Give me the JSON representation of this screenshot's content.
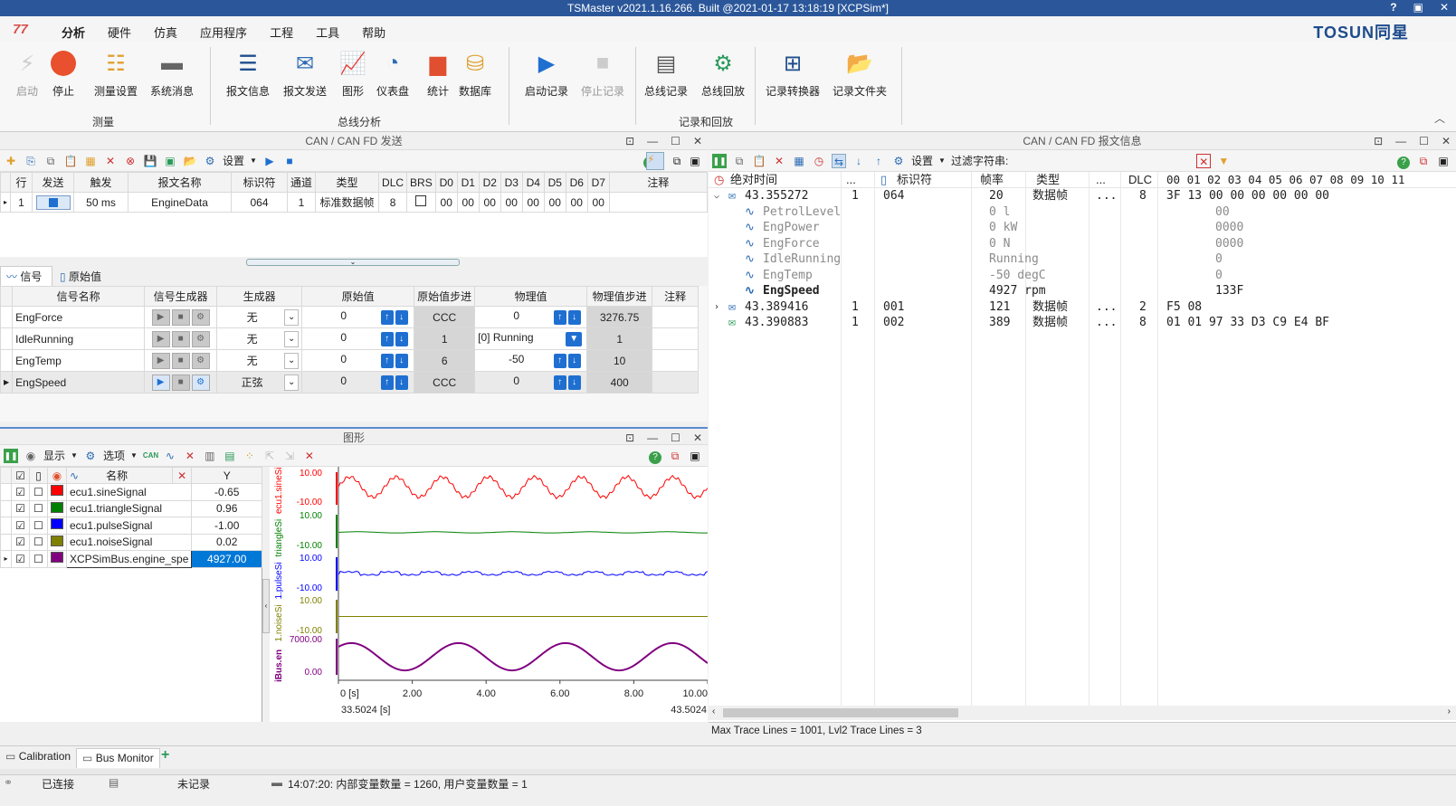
{
  "window": {
    "title": "TSMaster v2021.1.16.266. Built @2021-01-17 13:18:19 [XCPSim*]",
    "help": "?"
  },
  "menu": {
    "items": [
      "分析",
      "硬件",
      "仿真",
      "应用程序",
      "工程",
      "工具",
      "帮助"
    ],
    "brand": "TOSUN同星"
  },
  "ribbon": {
    "measure": {
      "label": "测量",
      "buttons": [
        "启动",
        "停止",
        "测量设置",
        "系统消息"
      ]
    },
    "bus": {
      "label": "总线分析",
      "buttons": [
        "报文信息",
        "报文发送",
        "图形",
        "仪表盘",
        "统计",
        "数据库"
      ]
    },
    "record": {
      "label": "记录和回放",
      "buttons": [
        "启动记录",
        "停止记录",
        "总线记录",
        "总线回放",
        "记录转换器",
        "记录文件夹"
      ]
    }
  },
  "send": {
    "title": "CAN / CAN FD 发送",
    "settings": "设置",
    "headers": [
      "行",
      "发送",
      "触发",
      "报文名称",
      "标识符",
      "通道",
      "类型",
      "DLC",
      "BRS",
      "D0",
      "D1",
      "D2",
      "D3",
      "D4",
      "D5",
      "D6",
      "D7",
      "注释"
    ],
    "row": {
      "n": "1",
      "trigger": "50 ms",
      "name": "EngineData",
      "id": "064",
      "ch": "1",
      "type": "标准数据帧",
      "dlc": "8",
      "d": [
        "00",
        "00",
        "00",
        "00",
        "00",
        "00",
        "00",
        "00"
      ]
    },
    "tabs": [
      "信号",
      "原始值"
    ],
    "sig_headers": [
      "信号名称",
      "信号生成器",
      "生成器",
      "原始值",
      "原始值步进",
      "物理值",
      "物理值步进",
      "注释"
    ],
    "signals": [
      {
        "name": "EngForce",
        "gen": "无",
        "raw": "0",
        "rawstep": "CCC",
        "phys": "0",
        "physstep": "3276.75"
      },
      {
        "name": "IdleRunning",
        "gen": "无",
        "raw": "0",
        "rawstep": "1",
        "phys": "[0] Running",
        "physstep": "1"
      },
      {
        "name": "EngTemp",
        "gen": "无",
        "raw": "0",
        "rawstep": "6",
        "phys": "-50",
        "physstep": "10"
      },
      {
        "name": "EngSpeed",
        "gen": "正弦",
        "raw": "0",
        "rawstep": "CCC",
        "phys": "0",
        "physstep": "400"
      }
    ]
  },
  "graph": {
    "title": "图形",
    "show": "显示",
    "options": "选项",
    "headers": [
      "名称",
      "Y"
    ],
    "signals": [
      {
        "name": "ecu1.sineSignal",
        "y": "-0.65",
        "color": "#ff0000"
      },
      {
        "name": "ecu1.triangleSignal",
        "y": "0.96",
        "color": "#008000"
      },
      {
        "name": "ecu1.pulseSignal",
        "y": "-1.00",
        "color": "#0000ff"
      },
      {
        "name": "ecu1.noiseSignal",
        "y": "0.02",
        "color": "#808000"
      },
      {
        "name": "XCPSimBus.engine_spe",
        "y": "4927.00",
        "color": "#800080"
      }
    ],
    "axis_labels": [
      "ecu1.sineSig",
      "triangleSi",
      "1.pulseSi",
      "1.noiseSi",
      "iBus.en"
    ],
    "yticks": [
      [
        "10.00",
        "-10.00"
      ],
      [
        "10.00",
        "-10.00"
      ],
      [
        "10.00",
        "-10.00"
      ],
      [
        "10.00",
        "-10.00"
      ],
      [
        "7000.00",
        "0.00"
      ]
    ],
    "xticks": [
      "0 [s]",
      "2.00",
      "4.00",
      "6.00",
      "8.00",
      "10.00"
    ],
    "start": "33.5024 [s]",
    "end": "43.5024"
  },
  "trace": {
    "title": "CAN / CAN FD 报文信息",
    "settings": "设置",
    "filter": "过滤字符串:",
    "headers": [
      "绝对时间",
      "...",
      "标识符",
      "帧率",
      "类型",
      "...",
      "DLC",
      "00 01 02 03 04 05 06 07 08 09 10 11"
    ],
    "msgs": [
      {
        "time": "43.355272",
        "ch": "1",
        "id": "064",
        "rate": "20",
        "type": "数据帧",
        "dots": "...",
        "dlc": "8",
        "data": "3F 13 00 00 00 00 00 00"
      },
      {
        "time": "43.389416",
        "ch": "1",
        "id": "001",
        "rate": "121",
        "type": "数据帧",
        "dots": "...",
        "dlc": "2",
        "data": "F5 08"
      },
      {
        "time": "43.390883",
        "ch": "1",
        "id": "002",
        "rate": "389",
        "type": "数据帧",
        "dots": "...",
        "dlc": "8",
        "data": "01 01 97 33 D3 C9 E4 BF"
      }
    ],
    "sigs": [
      {
        "name": "PetrolLevel",
        "val": "0 l",
        "raw": "00"
      },
      {
        "name": "EngPower",
        "val": "0 kW",
        "raw": "0000"
      },
      {
        "name": "EngForce",
        "val": "0 N",
        "raw": "0000"
      },
      {
        "name": "IdleRunning",
        "val": "Running",
        "raw": "0"
      },
      {
        "name": "EngTemp",
        "val": "-50 degC",
        "raw": "0"
      },
      {
        "name": "EngSpeed",
        "val": "4927 rpm",
        "raw": "133F"
      }
    ],
    "footer": "Max Trace Lines = 1001, Lvl2 Trace Lines = 3"
  },
  "tabs": [
    "Calibration",
    "Bus Monitor"
  ],
  "status": {
    "conn": "已连接",
    "rec": "未记录",
    "msg": "14:07:20: 内部变量数量 = 1260, 用户变量数量 = 1"
  },
  "chart_data": {
    "type": "line",
    "x_range": [
      0,
      10
    ],
    "series": [
      {
        "name": "ecu1.sineSignal",
        "ylim": [
          -10,
          10
        ]
      },
      {
        "name": "ecu1.triangleSignal",
        "ylim": [
          -10,
          10
        ]
      },
      {
        "name": "ecu1.pulseSignal",
        "ylim": [
          -10,
          10
        ]
      },
      {
        "name": "ecu1.noiseSignal",
        "ylim": [
          -10,
          10
        ]
      },
      {
        "name": "XCPSimBus.engine_spe",
        "ylim": [
          0,
          7000
        ]
      }
    ]
  }
}
